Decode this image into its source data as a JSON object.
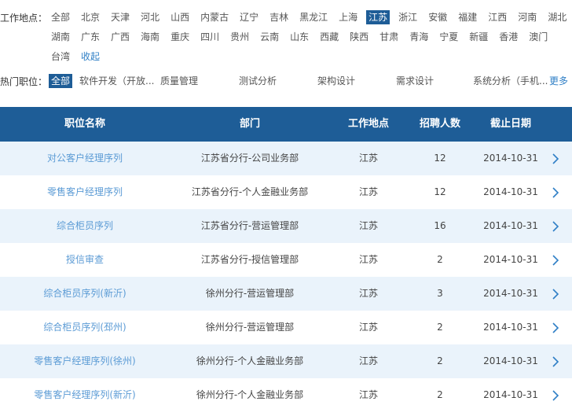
{
  "filter": {
    "location_label": "工作地点：",
    "locations_row1": [
      "全部",
      "北京",
      "天津",
      "河北",
      "山西",
      "内蒙古",
      "辽宁",
      "吉林",
      "黑龙江",
      "上海",
      "江苏",
      "浙江",
      "安徽",
      "福建",
      "江西",
      "河南",
      "湖北"
    ],
    "locations_row2": [
      "湖南",
      "广东",
      "广西",
      "海南",
      "重庆",
      "四川",
      "贵州",
      "云南",
      "山东",
      "西藏",
      "陕西",
      "甘肃",
      "青海",
      "宁夏",
      "新疆",
      "香港",
      "澳门"
    ],
    "locations_row3": [
      "台湾"
    ],
    "collapse_label": "收起",
    "active_location": "江苏",
    "hot_label": "热门职位：",
    "hot_positions": [
      "全部",
      "软件开发（开放...",
      "质量管理",
      "测试分析",
      "架构设计",
      "需求设计",
      "系统分析（手机..."
    ],
    "more_label": "更多"
  },
  "table": {
    "headers": [
      "职位名称",
      "部门",
      "工作地点",
      "招聘人数",
      "截止日期"
    ],
    "rows": [
      {
        "position": "对公客户经理序列",
        "department": "江苏省分行-公司业务部",
        "location": "江苏",
        "count": "12",
        "deadline": "2014-10-31"
      },
      {
        "position": "零售客户经理序列",
        "department": "江苏省分行-个人金融业务部",
        "location": "江苏",
        "count": "12",
        "deadline": "2014-10-31"
      },
      {
        "position": "综合柜员序列",
        "department": "江苏省分行-营运管理部",
        "location": "江苏",
        "count": "16",
        "deadline": "2014-10-31"
      },
      {
        "position": "授信审查",
        "department": "江苏省分行-授信管理部",
        "location": "江苏",
        "count": "2",
        "deadline": "2014-10-31"
      },
      {
        "position": "综合柜员序列(新沂)",
        "department": "徐州分行-营运管理部",
        "location": "江苏",
        "count": "3",
        "deadline": "2014-10-31"
      },
      {
        "position": "综合柜员序列(邳州)",
        "department": "徐州分行-营运管理部",
        "location": "江苏",
        "count": "2",
        "deadline": "2014-10-31"
      },
      {
        "position": "零售客户经理序列(徐州)",
        "department": "徐州分行-个人金融业务部",
        "location": "江苏",
        "count": "2",
        "deadline": "2014-10-31"
      },
      {
        "position": "零售客户经理序列(新沂)",
        "department": "徐州分行-个人金融业务部",
        "location": "江苏",
        "count": "2",
        "deadline": "2014-10-31"
      }
    ]
  },
  "colors": {
    "header_bg": "#1e5d97",
    "row_alt_bg": "#eaf3fb",
    "link": "#5b9bd5",
    "arrow": "#2f7fc6"
  },
  "icons": {
    "row_arrow": "chevron-right-icon"
  }
}
